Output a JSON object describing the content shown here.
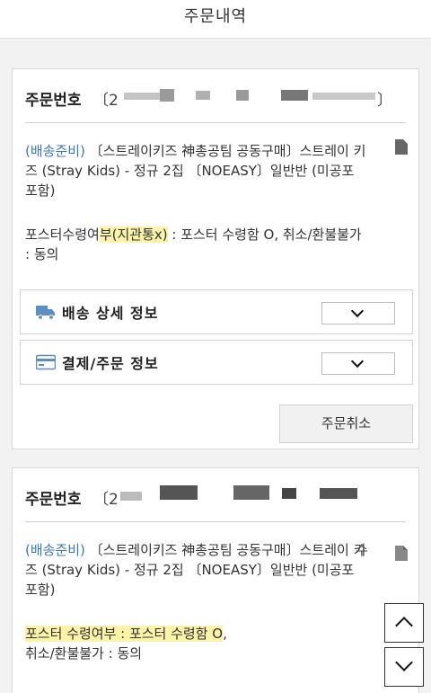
{
  "header": {
    "title": "주문내역"
  },
  "orders": [
    {
      "label": "주문번호",
      "number_prefix": "〔2",
      "number_suffix": "〕",
      "status": "(배송준비)",
      "product": " 〔스트레이키즈 神총공팀 공동구매〕스트레이 키즈 (Stray Kids) - 정규 2집 〔NOEASY〕일반반 (미공포 포함)",
      "option_a": "포스터수령여",
      "option_b": "부(지관통x)",
      "option_c": " : 포스터 수령함 O, 취소/환불불가 : 동의",
      "side_mark": ""
    },
    {
      "label": "주문번호",
      "number_prefix": "〔2",
      "number_suffix": "",
      "status": "(배송준비)",
      "product": " 〔스트레이키즈 神총공팀 공동구매〕스트레이 키즈 (Stray Kids) - 정규 2집 〔NOEASY〕일반반 (미공포 포함)",
      "option_a": "포스터 수령여부 : 포스터 수령함 O",
      "option_b": ",",
      "option_c": "취소/환불불가 : 동의",
      "side_mark": "수"
    }
  ],
  "sections": {
    "shipping": "배송 상세 정보",
    "payment": "결제/주문 정보"
  },
  "actions": {
    "cancel": "주문취소"
  },
  "icons": {
    "truck": "truck-icon",
    "card": "credit-card-icon",
    "chevron": "chevron-down-icon",
    "doc": "document-icon",
    "up": "chevron-up-icon",
    "down": "chevron-down-icon"
  },
  "colors": {
    "status": "#3a79b8",
    "icon_blue": "#5b8ec4",
    "highlight": "#fbf3a8"
  }
}
